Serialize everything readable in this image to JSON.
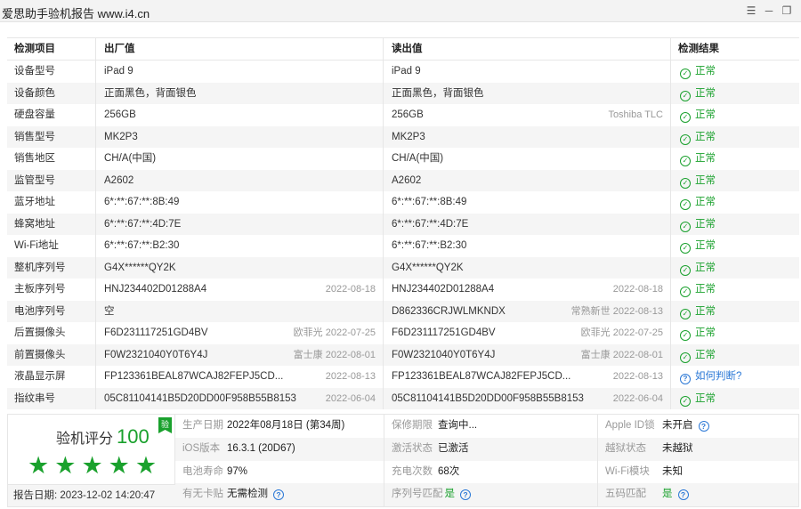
{
  "window": {
    "title": "爱思助手验机报告 www.i4.cn",
    "buttons": [
      "menu",
      "minimize",
      "restore"
    ]
  },
  "table": {
    "headers": [
      "检测项目",
      "出厂值",
      "读出值",
      "检测结果"
    ],
    "rows": [
      {
        "item": "设备型号",
        "factory": "iPad 9",
        "factory_note": "",
        "read": "iPad 9",
        "read_note": "",
        "result": "正常",
        "result_type": "ok"
      },
      {
        "item": "设备颜色",
        "factory": "正面黑色，背面银色",
        "factory_note": "",
        "read": "正面黑色，背面银色",
        "read_note": "",
        "result": "正常",
        "result_type": "ok"
      },
      {
        "item": "硬盘容量",
        "factory": "256GB",
        "factory_note": "",
        "read": "256GB",
        "read_note": "Toshiba TLC",
        "result": "正常",
        "result_type": "ok"
      },
      {
        "item": "销售型号",
        "factory": "MK2P3",
        "factory_note": "",
        "read": "MK2P3",
        "read_note": "",
        "result": "正常",
        "result_type": "ok"
      },
      {
        "item": "销售地区",
        "factory": "CH/A(中国)",
        "factory_note": "",
        "read": "CH/A(中国)",
        "read_note": "",
        "result": "正常",
        "result_type": "ok"
      },
      {
        "item": "监管型号",
        "factory": "A2602",
        "factory_note": "",
        "read": "A2602",
        "read_note": "",
        "result": "正常",
        "result_type": "ok"
      },
      {
        "item": "蓝牙地址",
        "factory": "6*:**:67:**:8B:49",
        "factory_note": "",
        "read": "6*:**:67:**:8B:49",
        "read_note": "",
        "result": "正常",
        "result_type": "ok"
      },
      {
        "item": "蜂窝地址",
        "factory": "6*:**:67:**:4D:7E",
        "factory_note": "",
        "read": "6*:**:67:**:4D:7E",
        "read_note": "",
        "result": "正常",
        "result_type": "ok"
      },
      {
        "item": "Wi-Fi地址",
        "factory": "6*:**:67:**:B2:30",
        "factory_note": "",
        "read": "6*:**:67:**:B2:30",
        "read_note": "",
        "result": "正常",
        "result_type": "ok"
      },
      {
        "item": "整机序列号",
        "factory": "G4X******QY2K",
        "factory_note": "",
        "read": "G4X******QY2K",
        "read_note": "",
        "result": "正常",
        "result_type": "ok"
      },
      {
        "item": "主板序列号",
        "factory": "HNJ234402D01288A4",
        "factory_note": "2022-08-18",
        "read": "HNJ234402D01288A4",
        "read_note": "2022-08-18",
        "result": "正常",
        "result_type": "ok"
      },
      {
        "item": "电池序列号",
        "factory": "空",
        "factory_note": "",
        "read": "D862336CRJWLMKNDX",
        "read_note": "常熟新世 2022-08-13",
        "result": "正常",
        "result_type": "ok"
      },
      {
        "item": "后置摄像头",
        "factory": "F6D231117251GD4BV",
        "factory_note": "欧菲光 2022-07-25",
        "read": "F6D231117251GD4BV",
        "read_note": "欧菲光 2022-07-25",
        "result": "正常",
        "result_type": "ok"
      },
      {
        "item": "前置摄像头",
        "factory": "F0W2321040Y0T6Y4J",
        "factory_note": "富士康 2022-08-01",
        "read": "F0W2321040Y0T6Y4J",
        "read_note": "富士康 2022-08-01",
        "result": "正常",
        "result_type": "ok"
      },
      {
        "item": "液晶显示屏",
        "factory": "FP123361BEAL87WCAJ82FEPJ5CD...",
        "factory_note": "2022-08-13",
        "read": "FP123361BEAL87WCAJ82FEPJ5CD...",
        "read_note": "2022-08-13",
        "result": "如何判断?",
        "result_type": "question"
      },
      {
        "item": "指纹串号",
        "factory": "05C81104141B5D20DD00F958B55B8153",
        "factory_note": "2022-06-04",
        "read": "05C81104141B5D20DD00F958B55B8153",
        "read_note": "2022-06-04",
        "result": "正常",
        "result_type": "ok"
      }
    ]
  },
  "score": {
    "label": "验机评分",
    "value": "100",
    "stars": 5,
    "badge": "验",
    "report_date_label": "报告日期:",
    "report_date": "2023-12-02 14:20:47"
  },
  "info": [
    [
      {
        "label": "生产日期",
        "value": "2022年08月18日 (第34周)",
        "help": false,
        "green": false
      },
      {
        "label": "保修期限",
        "value": "查询中...",
        "help": false,
        "green": false
      },
      {
        "label": "Apple ID锁",
        "value": "未开启",
        "help": true,
        "green": false
      }
    ],
    [
      {
        "label": "iOS版本",
        "value": "16.3.1 (20D67)",
        "help": false,
        "green": false
      },
      {
        "label": "激活状态",
        "value": "已激活",
        "help": false,
        "green": false
      },
      {
        "label": "越狱状态",
        "value": "未越狱",
        "help": false,
        "green": false
      }
    ],
    [
      {
        "label": "电池寿命",
        "value": "97%",
        "help": false,
        "green": false
      },
      {
        "label": "充电次数",
        "value": "68次",
        "help": false,
        "green": false
      },
      {
        "label": "Wi-Fi模块",
        "value": "未知",
        "help": false,
        "green": false
      }
    ],
    [
      {
        "label": "有无卡贴",
        "value": "无需检测",
        "help": true,
        "green": false
      },
      {
        "label": "序列号匹配",
        "value": "是",
        "help": true,
        "green": true
      },
      {
        "label": "五码匹配",
        "value": "是",
        "help": true,
        "green": true
      }
    ]
  ],
  "colors": {
    "accent": "#1aa12d",
    "link": "#2b78d6",
    "stripe": "#f5f5f5",
    "muted": "#999999"
  }
}
